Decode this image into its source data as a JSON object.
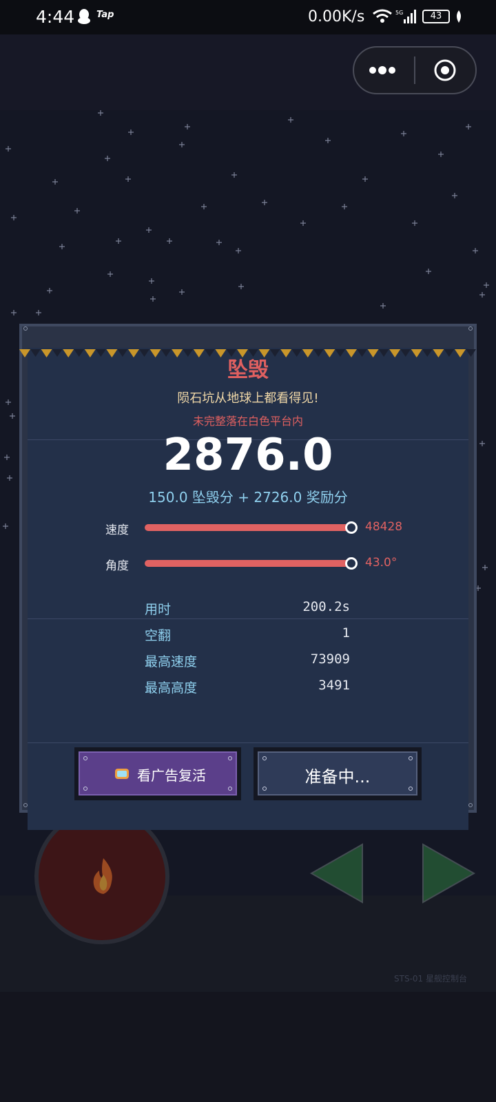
{
  "status_bar": {
    "time": "4:44",
    "app_label": "Tap",
    "network_speed": "0.00K/s",
    "network_type": "5G",
    "battery": "43"
  },
  "capsule": {
    "more_icon": "more-dots-icon",
    "close_icon": "target-circle-icon"
  },
  "result": {
    "title": "坠毁",
    "subtitle": "陨石坑从地球上都看得见!",
    "reason": "未完整落在白色平台内",
    "score": "2876.0",
    "breakdown": "150.0 坠毁分 + 2726.0 奖励分",
    "bars": [
      {
        "label": "速度",
        "value": "48428",
        "fill": 1.0
      },
      {
        "label": "角度",
        "value": "43.0°",
        "fill": 1.0
      }
    ],
    "stats": [
      {
        "label": "用时",
        "value": "200.2s"
      },
      {
        "label": "空翻",
        "value": "1"
      },
      {
        "label": "最高速度",
        "value": "73909"
      },
      {
        "label": "最高高度",
        "value": "3491"
      }
    ],
    "buttons": {
      "watch_ad": "看广告复活",
      "ready": "准备中..."
    }
  },
  "game": {
    "console_label": "STS-01  星舰控制台",
    "fire_icon": "flame-icon"
  },
  "colors": {
    "accent_red": "#e06262",
    "accent_blue": "#8fd0ee",
    "ad_purple": "#5b3f8a"
  }
}
